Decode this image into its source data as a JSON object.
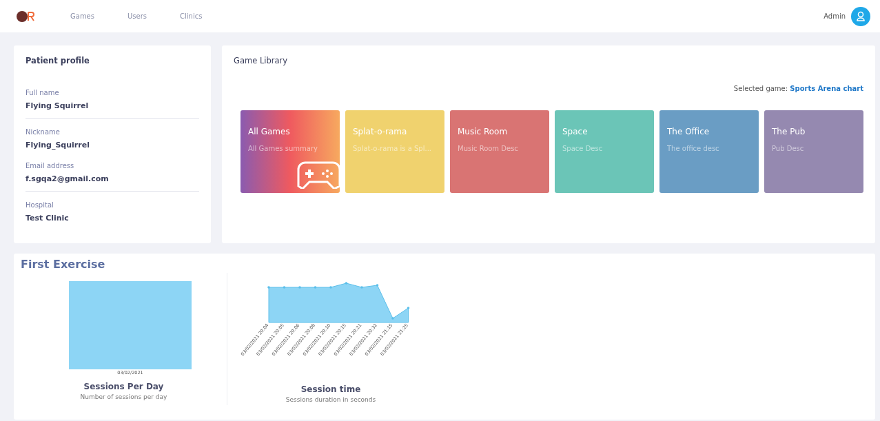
{
  "nav": {
    "links": [
      {
        "label": "Games"
      },
      {
        "label": "Users"
      },
      {
        "label": "Clinics"
      }
    ],
    "user": "Admin"
  },
  "profile": {
    "title": "Patient profile",
    "fields": [
      {
        "label": "Full name",
        "value": "Flying Squirrel",
        "divider": true
      },
      {
        "label": "Nickname",
        "value": "Flying_Squirrel",
        "divider": false
      },
      {
        "label": "Email address",
        "value": "f.sgqa2@gmail.com",
        "divider": true
      },
      {
        "label": "Hospital",
        "value": "Test Clinic",
        "divider": false
      }
    ]
  },
  "library": {
    "title": "Game Library",
    "selected_label": "Selected game:",
    "selected_value": "Sports Arena chart",
    "games": [
      {
        "kind": "summary",
        "title": "All Games",
        "desc": "All Games summary",
        "color": "#ef5a5f"
      },
      {
        "kind": "game",
        "title": "Splat-o-rama",
        "desc": "Splat-o-rama is a Spl...",
        "color": "#f0d26e"
      },
      {
        "kind": "game",
        "title": "Music Room",
        "desc": "Music Room Desc",
        "color": "#d97473"
      },
      {
        "kind": "game",
        "title": "Space",
        "desc": "Space Desc",
        "color": "#6bc5b7"
      },
      {
        "kind": "game",
        "title": "The Office",
        "desc": "The office desc",
        "color": "#6a9dc4"
      },
      {
        "kind": "game",
        "title": "The Pub",
        "desc": "Pub Desc",
        "color": "#9589b0"
      }
    ]
  },
  "exercise": {
    "title": "First Exercise",
    "charts": [
      {
        "kind": "bar",
        "x_labels": [
          "03/02/2021"
        ],
        "title": "Sessions Per Day",
        "subtitle": "Number of sessions per day"
      },
      {
        "kind": "area",
        "x_labels": [
          "03/02/2021 20:04",
          "03/02/2021 20:05",
          "03/02/2021 20:06",
          "03/02/2021 20:08",
          "03/02/2021 20:10",
          "03/02/2021 20:15",
          "03/02/2021 20:21",
          "03/02/2021 20:32",
          "03/02/2021 21:15",
          "03/02/2021 21:25"
        ],
        "title": "Session time",
        "subtitle": "Sessions duration in seconds"
      }
    ]
  }
}
